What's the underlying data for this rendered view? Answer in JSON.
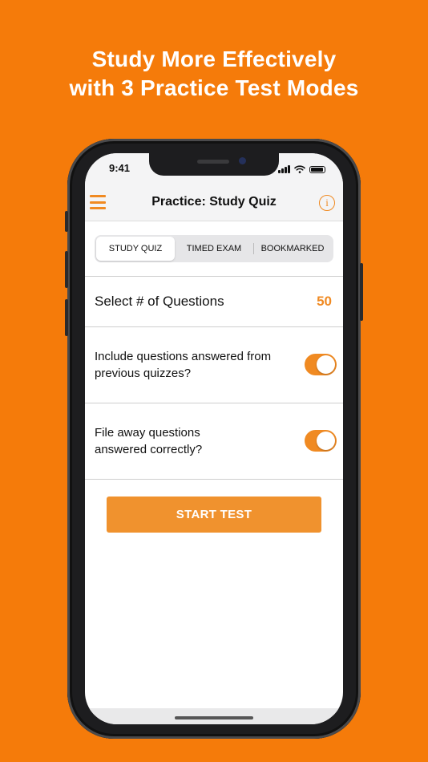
{
  "headline": {
    "line1": "Study More Effectively",
    "line2": "with 3 Practice Test Modes"
  },
  "status_bar": {
    "time": "9:41",
    "icons": [
      "signal-icon",
      "wifi-icon",
      "battery-icon"
    ]
  },
  "navbar": {
    "menu_icon": "hamburger-menu-icon",
    "title": "Practice: Study Quiz",
    "info_icon": "info-icon",
    "info_glyph": "i"
  },
  "tabs": [
    {
      "label": "STUDY QUIZ",
      "selected": true
    },
    {
      "label": "TIMED EXAM",
      "selected": false
    },
    {
      "label": "BOOKMARKED",
      "selected": false
    }
  ],
  "settings": {
    "questions_label": "Select # of Questions",
    "questions_value": "50",
    "include_previous": {
      "line1": "Include questions answered from",
      "line2": "previous quizzes?",
      "enabled": true
    },
    "file_away": {
      "line1": "File away questions",
      "line2": "answered correctly?",
      "enabled": true
    }
  },
  "start_button": "START TEST",
  "colors": {
    "background": "#F57B0A",
    "accent": "#F08A22",
    "button": "#F0922E"
  }
}
